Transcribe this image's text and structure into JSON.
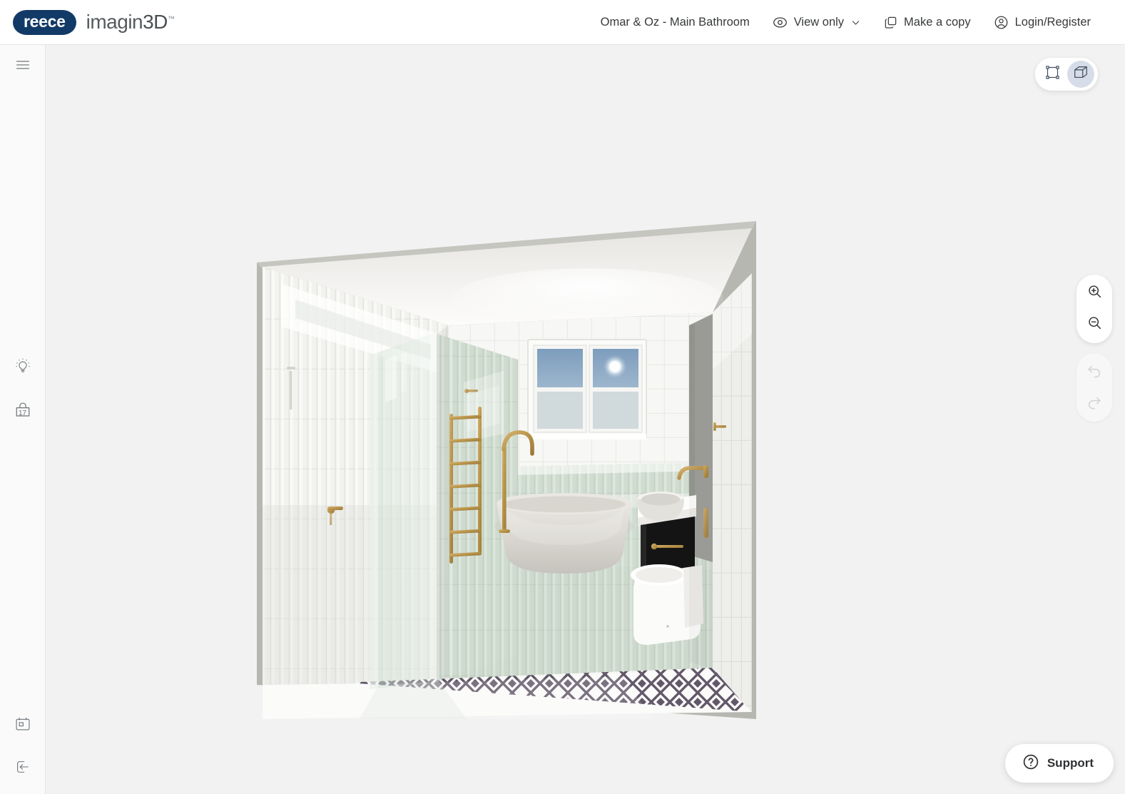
{
  "header": {
    "logo_reece": "reece",
    "logo_imagin_a": "imagin",
    "logo_imagin_b": "3D",
    "logo_tm": "™",
    "project_title": "Omar & Oz - Main Bathroom",
    "view_mode_label": "View only",
    "make_copy_label": "Make a copy",
    "login_label": "Login/Register",
    "icons": {
      "eye": "eye-icon",
      "chevron": "chevron-down-icon",
      "copy": "copy-icon",
      "user": "user-circle-icon"
    }
  },
  "sidebar": {
    "items": [
      {
        "name": "menu",
        "icon": "hamburger-menu-icon"
      },
      {
        "name": "inspiration",
        "icon": "lightbulb-icon"
      },
      {
        "name": "shopping-bag",
        "icon": "shopping-bag-icon",
        "badge": "17"
      },
      {
        "name": "plan",
        "icon": "calendar-icon"
      },
      {
        "name": "exit",
        "icon": "exit-icon"
      }
    ]
  },
  "canvas": {
    "view_toggle": {
      "floorplan_icon": "floorplan-2d-icon",
      "cube_icon": "cube-3d-icon",
      "active": "cube-3d-icon"
    },
    "tools": {
      "zoom_in_icon": "zoom-in-icon",
      "zoom_out_icon": "zoom-out-icon",
      "undo_icon": "undo-icon",
      "redo_icon": "redo-icon",
      "undo_enabled": false,
      "redo_enabled": false
    },
    "support": {
      "label": "Support",
      "icon": "question-circle-icon"
    },
    "scene": {
      "description": "3D rendered bathroom interior",
      "colors": {
        "canvas_bg": "#f2f2f2",
        "wall_tile_white": "#f4f4f2",
        "wall_tile_sage": "#cfdbd0",
        "ceiling": "#f0eeec",
        "floor_tile_dark": "#4e4452",
        "brass": "#bf9b50",
        "vanity_black": "#151515",
        "shell_grey": "#b3b3ad",
        "window_sky": "#8aa6c0"
      },
      "fixtures": [
        "freestanding-bath",
        "floor-bath-mixer",
        "vessel-basin",
        "wall-basin-mixer",
        "vanity-black-drawer",
        "toilet",
        "heated-towel-rail",
        "shower-mixer",
        "shower-rail-head",
        "glass-shower-screen",
        "window",
        "tall-cabinet"
      ]
    }
  }
}
